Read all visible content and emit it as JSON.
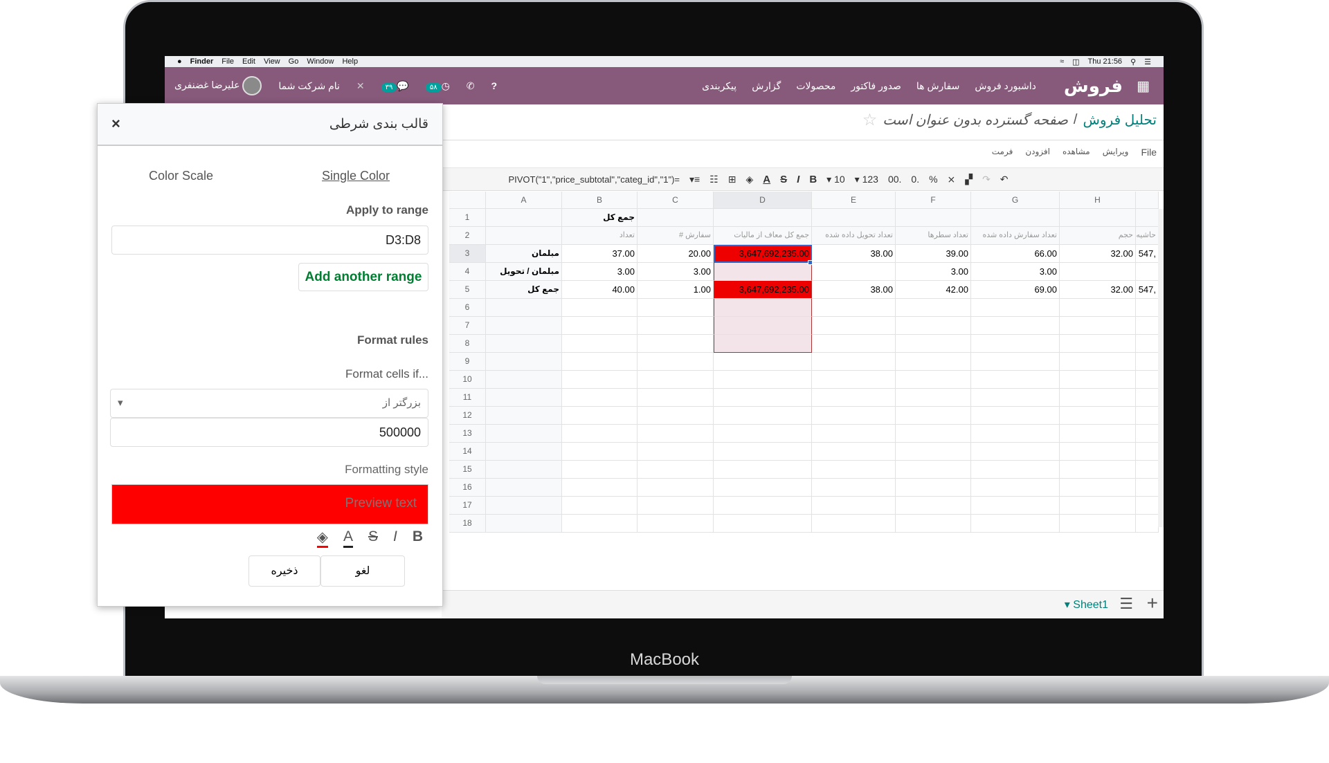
{
  "device": {
    "brand": "MacBook"
  },
  "macbar": {
    "items": [
      "Finder",
      "File",
      "Edit",
      "View",
      "Go",
      "Window",
      "Help"
    ],
    "clock": "Thu 21:56"
  },
  "nav": {
    "logo": "فروش",
    "items": [
      "داشبورد فروش",
      "سفارش ها",
      "صدور فاکتور",
      "محصولات",
      "گزارش",
      "پیکربندی"
    ],
    "badge_activities": "۵۸",
    "badge_messages": "۳۹",
    "company": "نام شرکت شما",
    "user": "علیرضا غضنفری",
    "color": "#875a7b"
  },
  "breadcrumb": {
    "parent": "تحلیل فروش",
    "sep": "/",
    "current": "صفحه گسترده بدون عنوان است"
  },
  "menu": [
    "File",
    "ویرایش",
    "مشاهده",
    "افزودن",
    "فرمت"
  ],
  "toolbar": {
    "formats": [
      "%",
      "0.",
      "00.",
      "123"
    ],
    "font_size": "10",
    "formula": "=PIVOT(\"1\",\"price_subtotal\",\"categ_id\",\"1\")"
  },
  "grid": {
    "columns": [
      "A",
      "B",
      "C",
      "D",
      "E",
      "F",
      "G",
      "H",
      ""
    ],
    "row_count": 18,
    "rows": {
      "1": {
        "B": "جمع کل"
      },
      "2": {
        "B": "تعداد",
        "C": "سفارش #",
        "D": "جمع کل معاف از مالیات",
        "E": "تعداد تحویل داده شده",
        "F": "تعداد سطرها",
        "G": "تعداد سفارش داده شده",
        "H": "حجم",
        "I": "حاشیه سود"
      },
      "3": {
        "A": "مبلمان",
        "B": "37.00",
        "C": "20.00",
        "D": "3,647,692,235.00",
        "E": "38.00",
        "F": "39.00",
        "G": "66.00",
        "H": "32.00",
        "I": "547,"
      },
      "4": {
        "A": "مبلمان / تحویل",
        "B": "3.00",
        "C": "3.00",
        "F": "3.00",
        "G": "3.00"
      },
      "5": {
        "A": "جمع کل",
        "B": "40.00",
        "C": "1.00",
        "D": "3,647,692,235.00",
        "E": "38.00",
        "F": "42.00",
        "G": "69.00",
        "H": "32.00",
        "I": "547,"
      }
    },
    "highlight_color": "#ee0000",
    "range_fill": "#f3e4ea",
    "selected_cell": "D3"
  },
  "sheets": {
    "active": "Sheet1"
  },
  "panel": {
    "title": "قالب بندی شرطی",
    "close": "×",
    "tab_scale": "Color Scale",
    "tab_single": "Single Color",
    "apply_label": "Apply to range",
    "range": "D3:D8",
    "add_range": "Add another range",
    "rules_label": "Format rules",
    "cells_if_label": "Format cells if...",
    "condition": "بزرگتر از",
    "value": "500000",
    "style_label": "Formatting style",
    "preview": "Preview text",
    "preview_fill": "#ff0000",
    "save": "ذخیره",
    "cancel": "لغو"
  }
}
